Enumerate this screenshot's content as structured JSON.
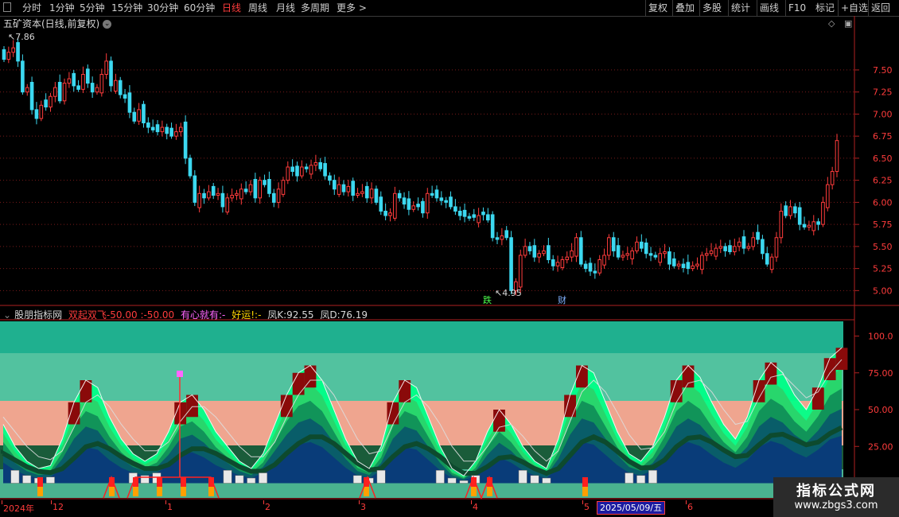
{
  "toolbar": {
    "left_items": [
      {
        "label": "分时",
        "active": false
      },
      {
        "label": "1分钟",
        "active": false
      },
      {
        "label": "5分钟",
        "active": false
      },
      {
        "label": "15分钟",
        "active": false
      },
      {
        "label": "30分钟",
        "active": false
      },
      {
        "label": "60分钟",
        "active": false
      },
      {
        "label": "日线",
        "active": true
      },
      {
        "label": "周线",
        "active": false
      },
      {
        "label": "月线",
        "active": false
      },
      {
        "label": "多周期",
        "active": false
      },
      {
        "label": "更多 >",
        "active": false
      }
    ],
    "right_items": [
      "复权",
      "叠加",
      "多股",
      "统计",
      "画线",
      "F10",
      "+自选",
      "返回"
    ],
    "extra_label": "标记"
  },
  "main_chart": {
    "title": "五矿资本(日线,前复权)",
    "high_label": "7.86",
    "low_label": "4.95",
    "marker_die": "跌",
    "marker_cai": "财",
    "y_ticks": [
      "7.50",
      "7.25",
      "7.00",
      "6.75",
      "6.50",
      "6.25",
      "6.00",
      "5.75",
      "5.50",
      "5.25",
      "5.00"
    ]
  },
  "indicator": {
    "name": "股朋指标网",
    "l1": "双起双飞",
    "v1": "-50.00",
    "v2": ":-50.00",
    "l2": "有心就有",
    "v3": ":-",
    "l3": "好运!",
    "v4": ":-",
    "k_label": "凤K",
    "k_value": ":92.55",
    "d_label": "凤D",
    "d_value": ":76.19",
    "y_ticks": [
      "100.0",
      "75.00",
      "50.00",
      "25.00",
      "0.00"
    ]
  },
  "date_axis": {
    "labels": [
      "2024年",
      "12",
      "1",
      "2",
      "3",
      "4",
      "5",
      "6"
    ],
    "highlight": "2025/05/09/五"
  },
  "watermark": {
    "logo": "指标公式网",
    "url": "www.zbgs3.com"
  },
  "colors": {
    "up": "#ff3c3c",
    "down": "#3cd8f0",
    "grid": "#7a1a1a",
    "accent": "#ff3c3c"
  },
  "chart_data": {
    "type": "candlestick",
    "title": "五矿资本(日线,前复权)",
    "ylim": [
      4.85,
      7.95
    ],
    "high": 7.86,
    "low": 4.95,
    "closes": [
      7.62,
      7.7,
      7.75,
      7.6,
      7.25,
      7.3,
      7.05,
      6.95,
      7.1,
      7.08,
      7.2,
      7.3,
      7.15,
      7.35,
      7.4,
      7.32,
      7.28,
      7.45,
      7.35,
      7.25,
      7.3,
      7.45,
      7.6,
      7.32,
      7.38,
      7.22,
      7.18,
      7.02,
      6.92,
      7.05,
      6.9,
      6.85,
      6.82,
      6.8,
      6.85,
      6.78,
      6.75,
      6.8,
      6.85,
      6.5,
      6.3,
      6.0,
      6.1,
      6.05,
      6.12,
      6.08,
      6.1,
      5.95,
      6.05,
      6.08,
      6.1,
      6.15,
      6.12,
      6.2,
      6.05,
      6.25,
      6.2,
      6.1,
      6.0,
      6.15,
      6.25,
      6.4,
      6.35,
      6.3,
      6.4,
      6.38,
      6.42,
      6.45,
      6.38,
      6.3,
      6.25,
      6.15,
      6.2,
      6.12,
      6.18,
      6.08,
      6.1,
      6.12,
      6.05,
      6.15,
      6.0,
      5.9,
      5.85,
      5.88,
      6.1,
      6.05,
      5.98,
      5.92,
      5.96,
      5.95,
      5.88,
      6.1,
      6.08,
      6.05,
      6.02,
      6.0,
      5.95,
      5.9,
      5.85,
      5.84,
      5.82,
      5.83,
      5.85,
      5.86,
      5.8,
      5.6,
      5.58,
      5.62,
      5.6,
      5.0,
      5.1,
      5.4,
      5.5,
      5.45,
      5.38,
      5.42,
      5.45,
      5.35,
      5.28,
      5.32,
      5.35,
      5.38,
      5.45,
      5.6,
      5.3,
      5.25,
      5.22,
      5.2,
      5.35,
      5.4,
      5.6,
      5.45,
      5.38,
      5.4,
      5.42,
      5.45,
      5.55,
      5.48,
      5.42,
      5.4,
      5.38,
      5.42,
      5.44,
      5.3,
      5.28,
      5.3,
      5.26,
      5.25,
      5.28,
      5.3,
      5.4,
      5.42,
      5.45,
      5.48,
      5.5,
      5.45,
      5.44,
      5.5,
      5.55,
      5.48,
      5.5,
      5.6,
      5.58,
      5.42,
      5.3,
      5.38,
      5.6,
      5.9,
      5.85,
      5.95,
      5.88,
      5.75,
      5.72,
      5.74,
      5.78,
      5.75,
      6.0,
      6.2,
      6.35,
      6.7
    ],
    "series": [
      {
        "name": "凤K",
        "values": [
          40,
          25,
          15,
          10,
          12,
          30,
          55,
          70,
          65,
          45,
          30,
          20,
          15,
          20,
          35,
          55,
          60,
          50,
          35,
          25,
          15,
          10,
          20,
          40,
          60,
          75,
          80,
          70,
          50,
          30,
          15,
          10,
          25,
          55,
          70,
          65,
          45,
          25,
          10,
          5,
          15,
          35,
          50,
          40,
          25,
          15,
          10,
          30,
          60,
          80,
          75,
          55,
          35,
          20,
          15,
          25,
          45,
          70,
          80,
          72,
          55,
          40,
          30,
          45,
          70,
          82,
          75,
          60,
          50,
          65,
          85,
          92
        ]
      },
      {
        "name": "凤D",
        "values": [
          45,
          35,
          25,
          18,
          16,
          22,
          38,
          55,
          60,
          52,
          40,
          30,
          22,
          22,
          28,
          42,
          52,
          52,
          45,
          35,
          25,
          18,
          18,
          28,
          45,
          60,
          70,
          70,
          60,
          45,
          30,
          20,
          22,
          40,
          55,
          60,
          52,
          40,
          25,
          15,
          15,
          25,
          38,
          40,
          32,
          22,
          15,
          22,
          42,
          62,
          70,
          62,
          48,
          33,
          23,
          24,
          35,
          55,
          68,
          70,
          62,
          50,
          40,
          42,
          58,
          72,
          74,
          66,
          58,
          62,
          75,
          84
        ]
      }
    ],
    "y2lim": [
      -10,
      110
    ]
  }
}
